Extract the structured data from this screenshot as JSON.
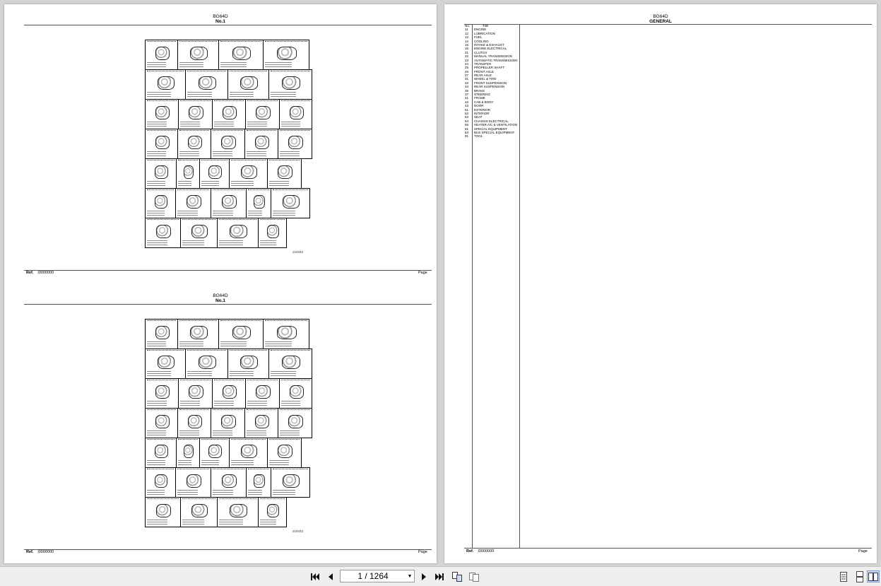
{
  "left_page": {
    "sheets": [
      {
        "model": "BG64D",
        "number": "No.1",
        "ref_label": "Ref.",
        "ref_value": "|0000000",
        "page_label": "Page",
        "figure_code": "218333"
      },
      {
        "model": "BG64D",
        "number": "No.1",
        "ref_label": "Ref.",
        "ref_value": "|0000000",
        "page_label": "Page",
        "figure_code": "218333"
      }
    ]
  },
  "right_page": {
    "model": "BG64D",
    "title": "GENERAL",
    "col_no": "No.",
    "col_title": "Title",
    "ref_label": "Ref.",
    "ref_value": "|0000000",
    "page_label": "Page",
    "items": [
      {
        "no": "11",
        "title": "ENGINE"
      },
      {
        "no": "12",
        "title": "LUBRICATION"
      },
      {
        "no": "13",
        "title": "FUEL"
      },
      {
        "no": "14",
        "title": "COOLING"
      },
      {
        "no": "15",
        "title": "INTAKE & EXHAUST"
      },
      {
        "no": "16",
        "title": "ENGINE ELECTRICAL"
      },
      {
        "no": "21",
        "title": "CLUTCH"
      },
      {
        "no": "22",
        "title": "MANUAL TRANSMISSION"
      },
      {
        "no": "23",
        "title": "AUTOMATIC TRANSMISSION"
      },
      {
        "no": "24",
        "title": "TRANSFER"
      },
      {
        "no": "25",
        "title": "PROPELLER SHAFT"
      },
      {
        "no": "26",
        "title": "FRONT AXLE"
      },
      {
        "no": "27",
        "title": "REAR AXLE"
      },
      {
        "no": "31",
        "title": "WHEEL & TIRE"
      },
      {
        "no": "33",
        "title": "FRONT SUSPENSION"
      },
      {
        "no": "34",
        "title": "REAR SUSPENSION"
      },
      {
        "no": "35",
        "title": "BRAKE"
      },
      {
        "no": "37",
        "title": "STEERING"
      },
      {
        "no": "41",
        "title": "FRAME"
      },
      {
        "no": "42",
        "title": "CAB & BODY"
      },
      {
        "no": "43",
        "title": "DOOR"
      },
      {
        "no": "51",
        "title": "EXTERIOR"
      },
      {
        "no": "52",
        "title": "INTERIOR"
      },
      {
        "no": "53",
        "title": "SEAT"
      },
      {
        "no": "54",
        "title": "CHASSIS ELECTRICAL"
      },
      {
        "no": "55",
        "title": "HEATER A/C & VENTILATION"
      },
      {
        "no": "61",
        "title": "SPECIAL EQUIPMENT"
      },
      {
        "no": "63",
        "title": "BUS SPECIAL EQUIPMENT"
      },
      {
        "no": "91",
        "title": "TOOL"
      }
    ]
  },
  "toolbar": {
    "page_indicator": "1 / 1264",
    "icons": {
      "first": "skip-first-icon",
      "prev": "prev-page-icon",
      "next": "next-page-icon",
      "last": "skip-last-icon",
      "rotate": "rotate-view-icon",
      "compare": "compare-view-icon",
      "single": "single-page-view-icon",
      "continuous": "continuous-view-icon",
      "facing": "facing-view-icon"
    }
  }
}
